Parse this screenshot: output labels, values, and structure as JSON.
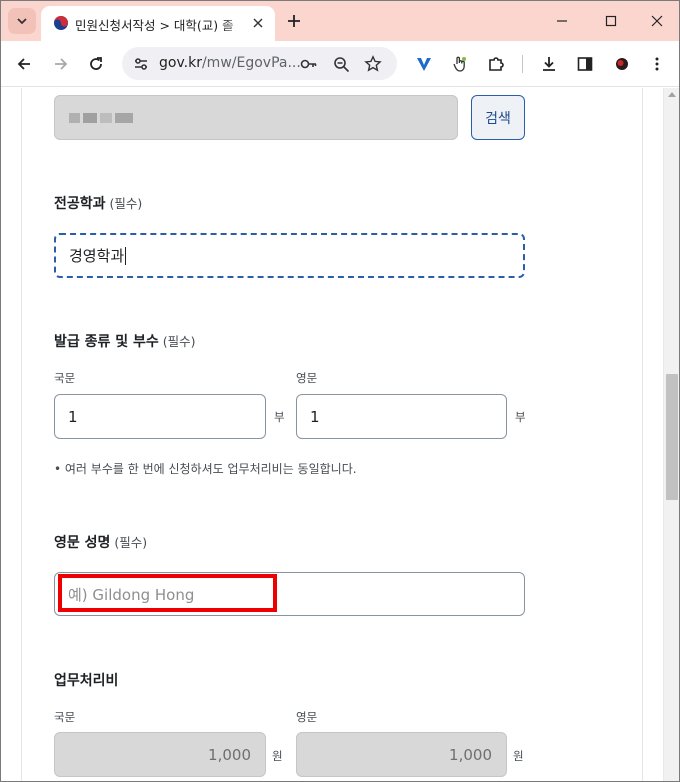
{
  "browser": {
    "tab_title": "민원신청서작성 > 대학(교) 졸",
    "url_main": "gov.kr",
    "url_rest": "/mw/EgovPa...",
    "accent_color": "#fad6cf"
  },
  "form": {
    "search_button_label": "검색",
    "major": {
      "label": "전공학과",
      "required": "(필수)",
      "value": "경영학과"
    },
    "issue": {
      "label": "발급 종류 및 부수",
      "required": "(필수)",
      "korean_label": "국문",
      "korean_value": "1",
      "korean_unit": "부",
      "english_label": "영문",
      "english_value": "1",
      "english_unit": "부",
      "note": "• 여러 부수를 한 번에 신청하셔도 업무처리비는 동일합니다."
    },
    "english_name": {
      "label": "영문 성명",
      "required": "(필수)",
      "placeholder": "예) Gildong Hong"
    },
    "fee": {
      "label": "업무처리비",
      "korean_label": "국문",
      "korean_value": "1,000",
      "korean_unit": "원",
      "english_label": "영문",
      "english_value": "1,000",
      "english_unit": "원"
    }
  }
}
